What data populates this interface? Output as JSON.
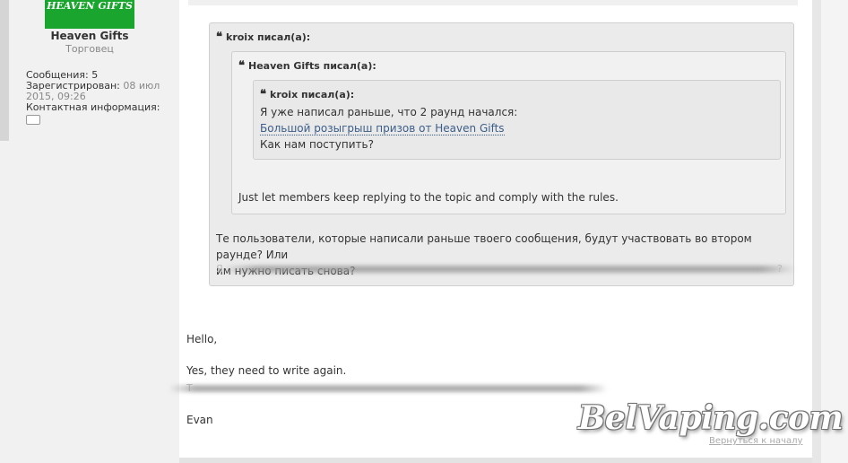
{
  "sidebar": {
    "avatar_text": "HEAVEN GIFTS",
    "username": "Heaven Gifts",
    "user_title": "Торговец",
    "posts_label": "Сообщения:",
    "posts_value": "5",
    "registered_label": "Зарегистрирован:",
    "registered_value_1": "08 июл",
    "registered_value_2": "2015, 09:26",
    "contact_label": "Контактная информация:",
    "contact_icon": "speech-bubble-icon"
  },
  "quotes": {
    "outer_author": "kroix писал(а):",
    "middle_author": "Heaven Gifts писал(а):",
    "inner_author": "kroix писал(а):",
    "inner_line1": "Я уже написал раньше, что 2 раунд начался:",
    "inner_link": "Большой розыгрыш призов от Heaven Gifts",
    "inner_line2": "Как нам поступить?",
    "middle_text": "Just let members keep replying to the topic and comply with the rules.",
    "outer_text_line1": "Те пользователи, которые написали раньше твоего сообщения, будут участвовать во втором раунде? Или",
    "outer_text_line2": "им нужно писать снова?",
    "outer_blur_start": "Я",
    "outer_blur_end": "?",
    "quote_mark": "❝"
  },
  "reply": {
    "greeting": "Hello,",
    "line1": "Yes, they need to write again.",
    "blur_start": "T",
    "signature": "Evan"
  },
  "footer": {
    "back_to_top": "Вернуться к началу"
  },
  "watermark": "BelVaping.com"
}
